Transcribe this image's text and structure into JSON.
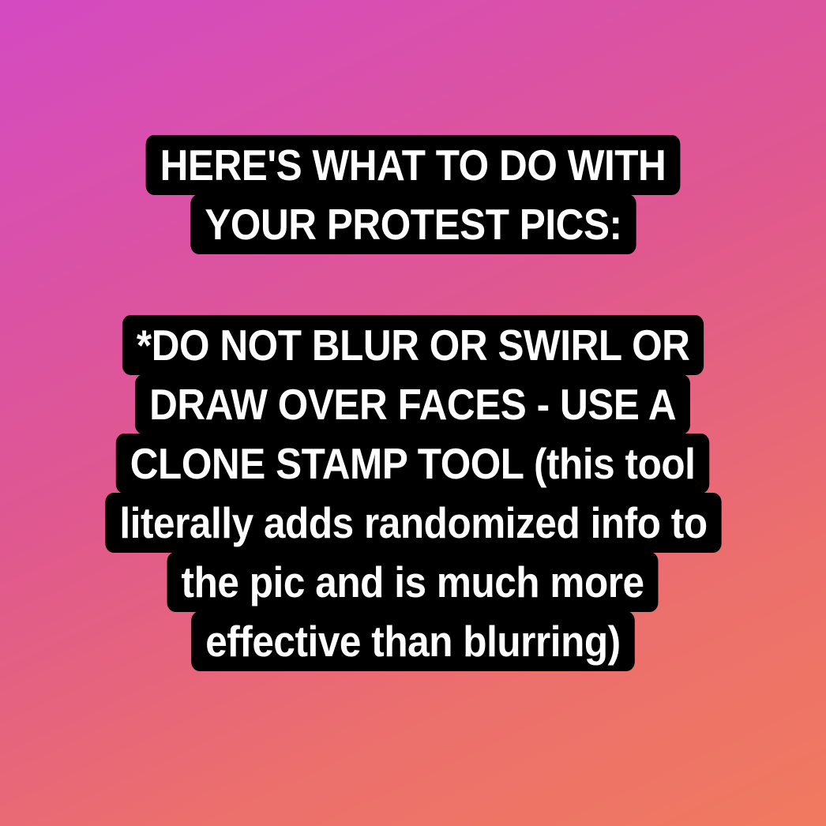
{
  "story": {
    "heading_lines": [
      "HERE'S WHAT TO DO WITH",
      "YOUR PROTEST PICS:"
    ],
    "body_lines": [
      "*DO NOT BLUR OR SWIRL OR",
      "DRAW OVER FACES - USE A",
      "CLONE STAMP TOOL (this tool",
      "literally adds randomized info to",
      "the pic and is much more",
      "effective than blurring)"
    ]
  },
  "colors": {
    "gradient_start": "#d44ac2",
    "gradient_end": "#f07a5f",
    "text_background": "#000000",
    "text": "#ffffff"
  }
}
